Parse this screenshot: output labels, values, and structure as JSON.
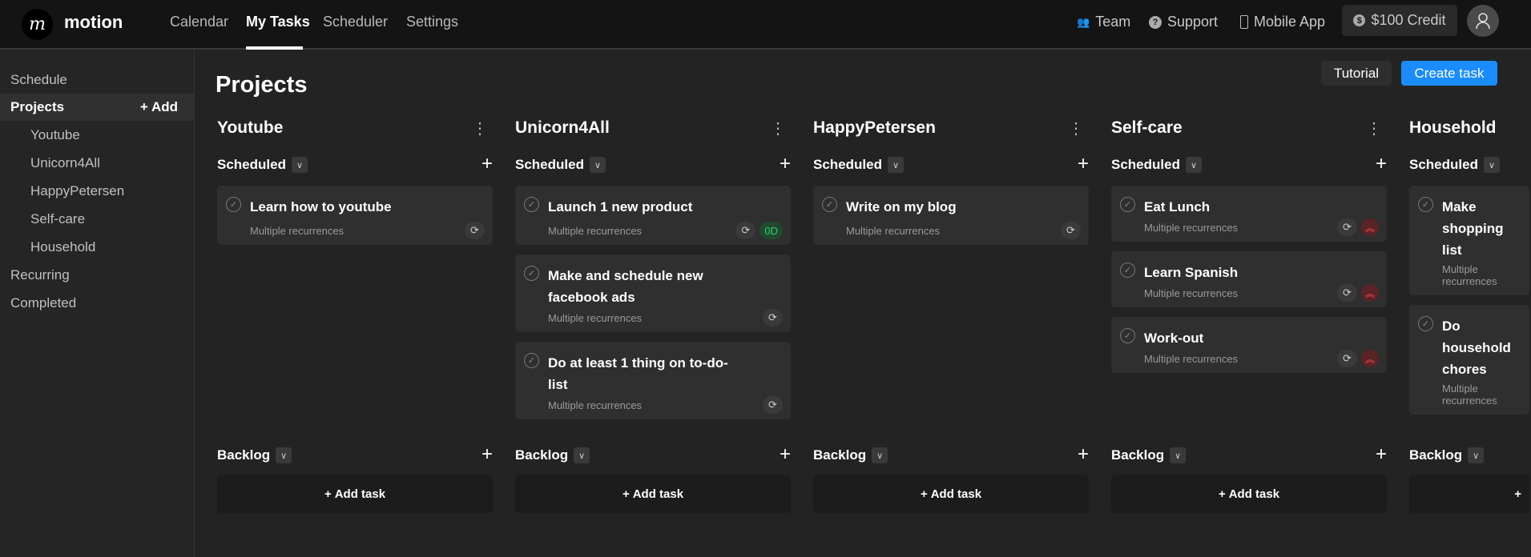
{
  "nav": {
    "brand": "motion",
    "links": [
      "Calendar",
      "My Tasks",
      "Scheduler",
      "Settings"
    ],
    "active": "My Tasks",
    "team": "Team",
    "support": "Support",
    "mobile": "Mobile App",
    "credit": "$100 Credit"
  },
  "sidebar": {
    "schedule": "Schedule",
    "projects": "Projects",
    "add": "+ Add",
    "items": [
      "Youtube",
      "Unicorn4All",
      "HappyPetersen",
      "Self-care",
      "Household"
    ],
    "recurring": "Recurring",
    "completed": "Completed"
  },
  "page": {
    "title": "Projects",
    "tutorial": "Tutorial",
    "create": "Create task",
    "accent": "#1a8cff"
  },
  "labels": {
    "scheduled": "Scheduled",
    "backlog": "Backlog",
    "add_task": "Add task"
  },
  "columns": [
    {
      "name": "Youtube",
      "tasks": [
        {
          "title": "Learn how to youtube",
          "sub": "Multiple recurrences",
          "badge": null
        }
      ]
    },
    {
      "name": "Unicorn4All",
      "tasks": [
        {
          "title": "Launch 1 new product",
          "sub": "Multiple recurrences",
          "badge": "0D"
        },
        {
          "title": "Make and schedule new facebook ads",
          "sub": "Multiple recurrences",
          "badge": null
        },
        {
          "title": "Do at least 1 thing on to-do-list",
          "sub": "Multiple recurrences",
          "badge": null
        }
      ]
    },
    {
      "name": "HappyPetersen",
      "tasks": [
        {
          "title": "Write on my blog",
          "sub": "Multiple recurrences",
          "badge": null
        }
      ]
    },
    {
      "name": "Self-care",
      "tasks": [
        {
          "title": "Eat Lunch",
          "sub": "Multiple recurrences",
          "badge": "urgent"
        },
        {
          "title": "Learn Spanish",
          "sub": "Multiple recurrences",
          "badge": "urgent"
        },
        {
          "title": "Work-out",
          "sub": "Multiple recurrences",
          "badge": "urgent"
        }
      ]
    },
    {
      "name": "Household",
      "tasks": [
        {
          "title": "Make shopping list",
          "sub": "Multiple recurrences",
          "badge": null
        },
        {
          "title": "Do household chores",
          "sub": "Multiple recurrences",
          "badge": null
        }
      ]
    }
  ]
}
